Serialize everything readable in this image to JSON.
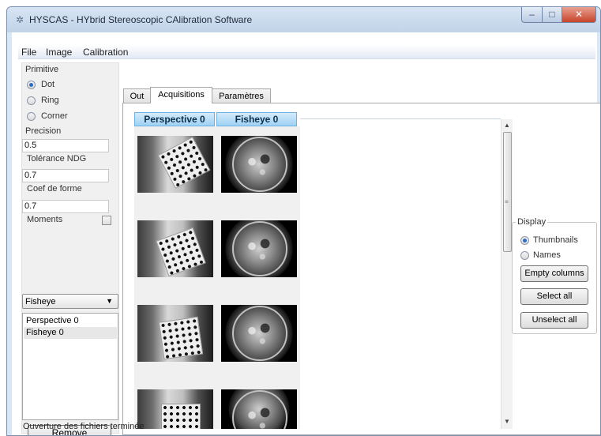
{
  "window": {
    "title": "HYSCAS - HYbrid Stereoscopic CAlibration Software"
  },
  "menu": [
    "File",
    "Image",
    "Calibration"
  ],
  "left_panel": {
    "primitive_label": "Primitive",
    "primitives": [
      {
        "label": "Dot",
        "selected": true
      },
      {
        "label": "Ring",
        "selected": false
      },
      {
        "label": "Corner",
        "selected": false
      }
    ],
    "precision_label": "Precision",
    "precision_value": "0.5",
    "tolerance_label": "Tolérance NDG",
    "tolerance_value": "0.7",
    "shape_label": "Coef de forme",
    "shape_value": "0.7",
    "moments_label": "Moments",
    "moments_checked": false,
    "camera_combo": "Fisheye",
    "list_items": [
      "Perspective 0",
      "Fisheye 0"
    ],
    "remove_label": "Remove"
  },
  "tabs": [
    "Out",
    "Acquisitions",
    "Paramètres"
  ],
  "active_tab": "Acquisitions",
  "columns": [
    "Perspective 0",
    "Fisheye 0"
  ],
  "display": {
    "title": "Display",
    "options": [
      {
        "label": "Thumbnails",
        "selected": true
      },
      {
        "label": "Names",
        "selected": false
      }
    ],
    "empty_columns": "Empty columns",
    "select_all": "Select all",
    "unselect_all": "Unselect all"
  },
  "status": "Ouverture des fichiers terminée",
  "icons": {
    "app": "app-logo-icon",
    "minimize": "minimize-icon",
    "maximize": "maximize-icon",
    "close": "close-icon",
    "dropdown": "chevron-down-icon"
  }
}
